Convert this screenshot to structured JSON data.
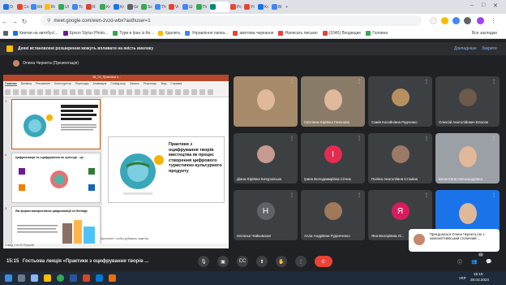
{
  "browser": {
    "tabs": [
      {
        "label": "O",
        "color": "#1a73e8"
      },
      {
        "label": "Co",
        "color": "#ea4335"
      },
      {
        "label": "Rh",
        "color": "#4285f4"
      },
      {
        "label": "Ri",
        "color": "#fbbc04"
      },
      {
        "label": "Ul",
        "color": "#34a853"
      },
      {
        "label": "Tc",
        "color": "#4285f4"
      },
      {
        "label": "R",
        "color": "#db4437"
      },
      {
        "label": "Kr",
        "color": "#34a853"
      },
      {
        "label": "Kr",
        "color": "#1a73e8"
      },
      {
        "label": "Gr",
        "color": "#5f6368"
      },
      {
        "label": "Sc",
        "color": "#34a853"
      },
      {
        "label": "Th",
        "color": "#4285f4"
      },
      {
        "label": "Vi",
        "color": "#ea4335"
      },
      {
        "label": "Ш",
        "color": "#4285f4"
      },
      {
        "label": "Пr",
        "color": "#34a853"
      },
      {
        "label": "",
        "color": "#00897b",
        "active": true
      },
      {
        "label": "Pc",
        "color": "#ea4335"
      },
      {
        "label": "Yt",
        "color": "#ea4335"
      },
      {
        "label": "Kr",
        "color": "#1a73e8"
      },
      {
        "label": "Bi",
        "color": "#4285f4"
      }
    ],
    "url": "meet.google.com/ewn-zvzd-wbx?authuser=1",
    "bookmarks": [
      "Квитки на автобус/...",
      "Epson Stylus Photo...",
      "Тури в Іран із Ки...",
      "Удалить",
      "Управління папка...",
      "амотова черкання",
      "Написать письмо",
      "(1040) Входящие",
      "Головна"
    ],
    "all_bookmarks_label": "Все закладки"
  },
  "meet": {
    "banner_text": "Деякі встановлені розширення можуть впливати на якість виклику",
    "banner_details": "Докладніше",
    "banner_close": "Закрити",
    "presenter_label": "Олена Чернета (Презентація)",
    "time": "15:15",
    "meeting_title": "Гостьова лекція «Практики з оцифрування творів ...",
    "participants_count": "19"
  },
  "ppt": {
    "filename": "08_01_Практики з...",
    "menus": [
      "Главная",
      "Вставка",
      "Рисование",
      "Конструктор",
      "Переходы",
      "Анимация",
      "Слайд-шоу",
      "Запись",
      "Рецензир.",
      "Вид",
      "Справка"
    ],
    "slide_title": "Практики з оцифрування творів мистецтва як процес створення цифрового туристично-культурного продукту",
    "slide2_title": "Цифровізація та оцифрування по культурі - це:",
    "slide3_title": "Які форми використання цифровізації та Heritage",
    "notes_placeholder": "Щелкните, чтобы добавить заметки",
    "status": "Слайд 1 из 30   Русский"
  },
  "participants": [
    {
      "name": "",
      "kind": "video",
      "bg": "#a68a6a"
    },
    {
      "name": "Світлана Юріївна Гапонова",
      "kind": "video",
      "bg": "#8a7a68"
    },
    {
      "name": "Самія Косейнівна Радченко",
      "kind": "photo",
      "bg": "#3c4043",
      "avatar": "#b89060"
    },
    {
      "name": "Олексій Анатолійович Власов",
      "kind": "photo",
      "bg": "#3c4043",
      "avatar": "#6d5a4a"
    },
    {
      "name": "Діана Юріївна Качуровська",
      "kind": "photo",
      "bg": "#3c4043",
      "avatar": "#c79a8f"
    },
    {
      "name": "Ірина Володимирівна Сітник",
      "kind": "letter",
      "bg": "#3c4043",
      "letter": "І",
      "avatar": "#e52b50"
    },
    {
      "name": "Поліна Анатоліївна Істоміна",
      "kind": "photo",
      "bg": "#3c4043",
      "avatar": "#9c7a68"
    },
    {
      "name": "Валентина Олександрівна ...",
      "kind": "video",
      "bg": "#9aa0a6"
    },
    {
      "name": "Наталья Чайковская",
      "kind": "letter",
      "bg": "#3c4043",
      "letter": "Н",
      "avatar": "#5f6368"
    },
    {
      "name": "Алла Андріївна Руденченко",
      "kind": "photo",
      "bg": "#3c4043",
      "avatar": "#a0785a"
    },
    {
      "name": "Яна Валеріївна Лі...",
      "kind": "letter",
      "bg": "#3c4043",
      "letter": "Я",
      "avatar": "#d81b60"
    },
    {
      "name": "",
      "kind": "video",
      "bg": "#1a73e8"
    }
  ],
  "toast": {
    "title": "Приєдналася Олена Чернета (не з компанії Київський столичний ..."
  },
  "taskbar": {
    "lang": "УКР",
    "time": "15:15",
    "date": "28.03.2024"
  }
}
